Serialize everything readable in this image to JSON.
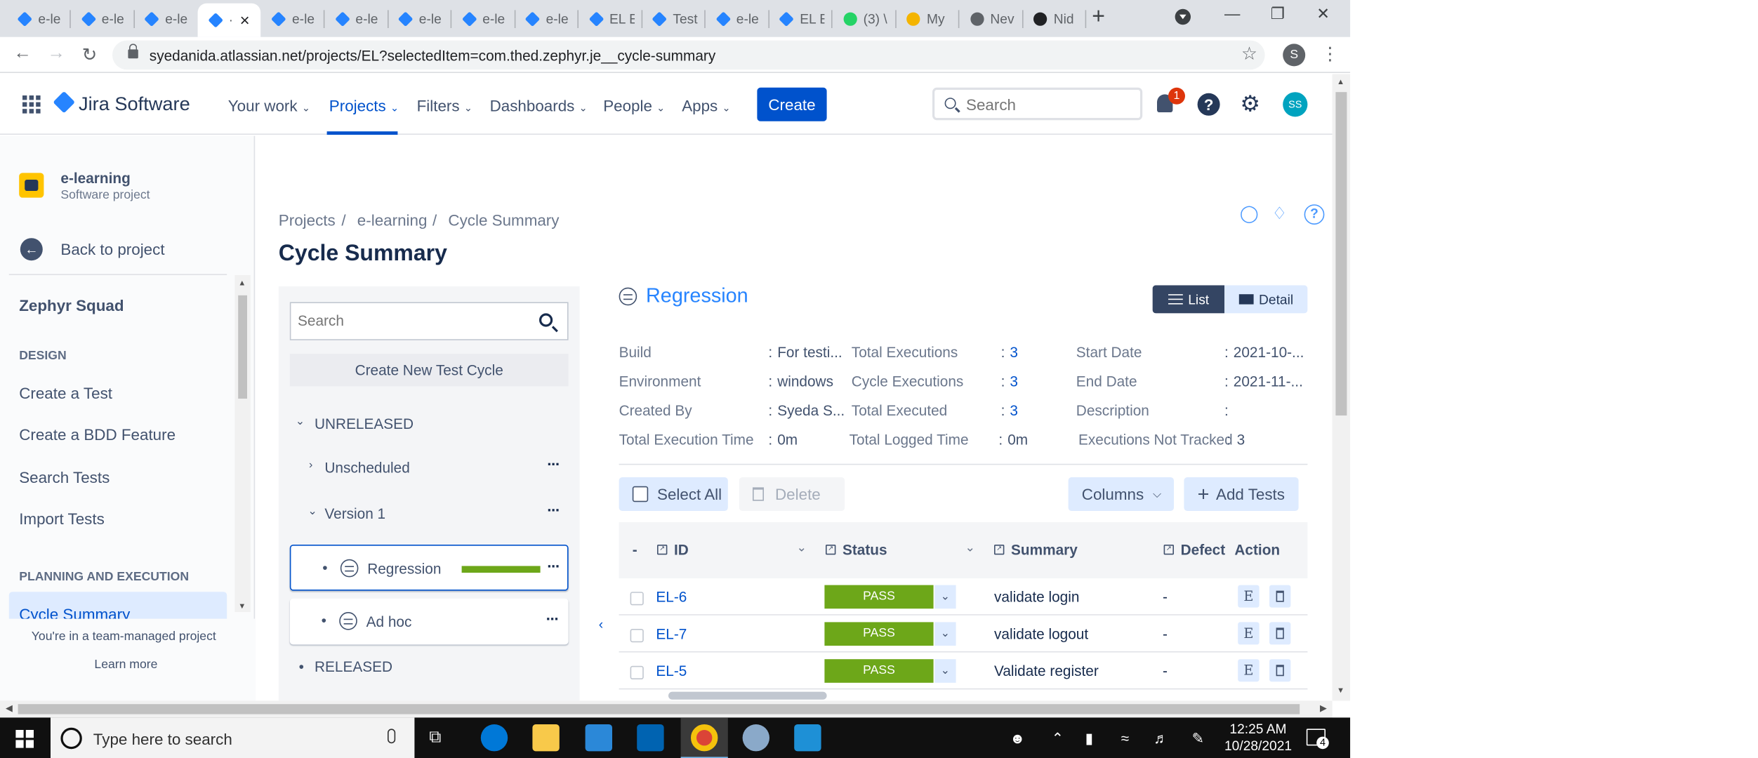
{
  "browser": {
    "tabs": [
      {
        "label": "e-le",
        "favicon": "jira-icon",
        "color": "#2684ff"
      },
      {
        "label": "e-le",
        "favicon": "jira-icon",
        "color": "#2684ff"
      },
      {
        "label": "e-le",
        "favicon": "jira-icon",
        "color": "#2684ff"
      },
      {
        "label": "·",
        "favicon": "jira-icon",
        "color": "#2684ff",
        "active": true
      },
      {
        "label": "e-le",
        "favicon": "jira-icon",
        "color": "#2684ff"
      },
      {
        "label": "e-le",
        "favicon": "jira-icon",
        "color": "#2684ff"
      },
      {
        "label": "e-le",
        "favicon": "jira-icon",
        "color": "#2684ff"
      },
      {
        "label": "e-le",
        "favicon": "jira-icon",
        "color": "#2684ff"
      },
      {
        "label": "e-le",
        "favicon": "jira-icon",
        "color": "#2684ff"
      },
      {
        "label": "EL E",
        "favicon": "jira-icon",
        "color": "#2684ff"
      },
      {
        "label": "Test",
        "favicon": "jira-icon",
        "color": "#2684ff"
      },
      {
        "label": "e-le",
        "favicon": "jira-icon",
        "color": "#2684ff"
      },
      {
        "label": "EL E",
        "favicon": "jira-icon",
        "color": "#2684ff"
      },
      {
        "label": "(3) \\",
        "favicon": "whatsapp-icon",
        "color": "#25d366"
      },
      {
        "label": "My",
        "favicon": "drive-icon",
        "color": "#f4b400"
      },
      {
        "label": "Nev",
        "favicon": "chrome-icon",
        "color": "#5f6368"
      },
      {
        "label": "Nid",
        "favicon": "github-icon",
        "color": "#202124"
      }
    ],
    "new_tab": "+",
    "url": "syedanida.atlassian.net/projects/EL?selectedItem=com.thed.zephyr.je__cycle-summary",
    "profile_initial": "S"
  },
  "jira_nav": {
    "product": "Jira Software",
    "items": [
      "Your work",
      "Projects",
      "Filters",
      "Dashboards",
      "People",
      "Apps"
    ],
    "active_item": "Projects",
    "create_label": "Create",
    "search_placeholder": "Search",
    "notification_count": "1",
    "help_glyph": "?",
    "avatar_initials": "SS"
  },
  "sidebar": {
    "project_name": "e-learning",
    "project_type": "Software project",
    "back_label": "Back to project",
    "title": "Zephyr Squad",
    "design_heading": "DESIGN",
    "design_links": [
      "Create a Test",
      "Create a BDD Feature",
      "Search Tests",
      "Import Tests"
    ],
    "planning_heading": "PLANNING AND EXECUTION",
    "active_link": "Cycle Summary",
    "footer_text": "You're in a team-managed project",
    "learn_more": "Learn more"
  },
  "breadcrumb": [
    "Projects",
    "e-learning",
    "Cycle Summary"
  ],
  "breadcrumb_sep": "/",
  "page_title": "Cycle Summary",
  "tree": {
    "search_placeholder": "Search",
    "create_label": "Create New Test Cycle",
    "unreleased": "UNRELEASED",
    "unscheduled": "Unscheduled",
    "version": "Version 1",
    "cycles": [
      {
        "name": "Regression",
        "progress": 1.0,
        "selected": true
      },
      {
        "name": "Ad hoc"
      }
    ],
    "released": "RELEASED",
    "bullet": "•"
  },
  "cycle": {
    "name": "Regression",
    "view_list": "List",
    "view_detail": "Detail",
    "info": {
      "build_label": "Build",
      "build_value": "For testi...",
      "environment_label": "Environment",
      "environment_value": "windows",
      "created_by_label": "Created By",
      "created_by_value": "Syeda S...",
      "exec_time_label": "Total Execution Time",
      "exec_time_value": "0m",
      "total_exec_label": "Total Executions",
      "total_exec_value": "3",
      "cycle_exec_label": "Cycle Executions",
      "cycle_exec_value": "3",
      "total_executed_label": "Total Executed",
      "total_executed_value": "3",
      "logged_time_label": "Total Logged Time",
      "logged_time_value": "0m",
      "start_label": "Start Date",
      "start_value": "2021-10-...",
      "end_label": "End Date",
      "end_value": "2021-11-...",
      "desc_label": "Description",
      "desc_value": "",
      "not_tracked_label": "Executions Not Tracked",
      "not_tracked_value": "3"
    },
    "colon": ":",
    "select_all": "Select All",
    "delete": "Delete",
    "columns": "Columns",
    "add_tests": "Add Tests"
  },
  "table": {
    "headers": {
      "dash": "-",
      "id": "ID",
      "status": "Status",
      "summary": "Summary",
      "defect": "Defect",
      "action": "Action"
    },
    "rows": [
      {
        "id": "EL-6",
        "status": "PASS",
        "summary": "validate login",
        "defect": "-"
      },
      {
        "id": "EL-7",
        "status": "PASS",
        "summary": "validate logout",
        "defect": "-"
      },
      {
        "id": "EL-5",
        "status": "PASS",
        "summary": "Validate register",
        "defect": "-"
      }
    ],
    "edit_glyph": "E",
    "pass_color": "#6da719"
  },
  "taskbar": {
    "search_placeholder": "Type here to search",
    "time": "12:25 AM",
    "date": "10/28/2021",
    "notification_count": "4"
  }
}
